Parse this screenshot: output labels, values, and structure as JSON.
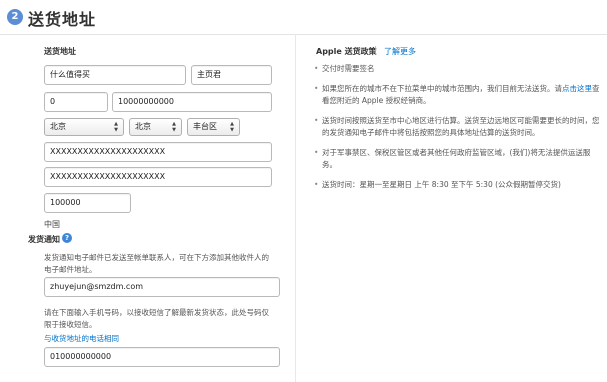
{
  "header": {
    "step_number": "2",
    "title": "送货地址"
  },
  "form": {
    "address_heading": "送货地址",
    "name_value": "什么值得买",
    "surname_value": "主页君",
    "area_code_value": "0",
    "phone_value": "10000000000",
    "province_value": "北京",
    "city_value": "北京",
    "district_value": "丰台区",
    "address_line1_value": "XXXXXXXXXXXXXXXXXXXXX",
    "address_line2_value": "XXXXXXXXXXXXXXXXXXXXX",
    "postal_code_value": "100000",
    "country_text": "中国"
  },
  "notification": {
    "heading": "发货通知",
    "help_icon_glyph": "?",
    "email_description": "发货通知电子邮件已发送至帐单联系人，可在下方添加其他收件人的电子邮件地址。",
    "email_value": "zhuyejun@smzdm.com",
    "sms_description": "请在下面输入手机号码，以接收短信了解最新发货状态，此处号码仅限于接收短信。",
    "same_as_shipping_link": "与收货地址的电话相同",
    "mobile_value": "010000000000"
  },
  "policy": {
    "title": "Apple 送货政策",
    "separator": "|",
    "learn_more_link": "了解更多",
    "items": [
      {
        "text": "交付时需要签名"
      },
      {
        "text_before": "如果您所在的城市不在下拉菜单中的城市范围内，我们目前无法送货。请",
        "link": "点击这里",
        "text_after": "查看您附近的 Apple 授权经销商。"
      },
      {
        "text": "送货时间按照送货至市中心地区进行估算。送货至边远地区可能需要更长的时间，您的发货通知电子邮件中将包括按照您的具体地址估算的送货时间。"
      },
      {
        "text": "对于军事禁区、保税区管区或者其他任何政府监管区域，(我们)将无法提供运送服务。"
      },
      {
        "text": "送货时间：星期一至星期日 上午 8:30 至下午 5:30 (公众假期暂停交货)"
      }
    ]
  },
  "colors": {
    "link": "#0070c9",
    "step_badge": "#5b8ed4",
    "help_icon": "#3d86d7"
  }
}
